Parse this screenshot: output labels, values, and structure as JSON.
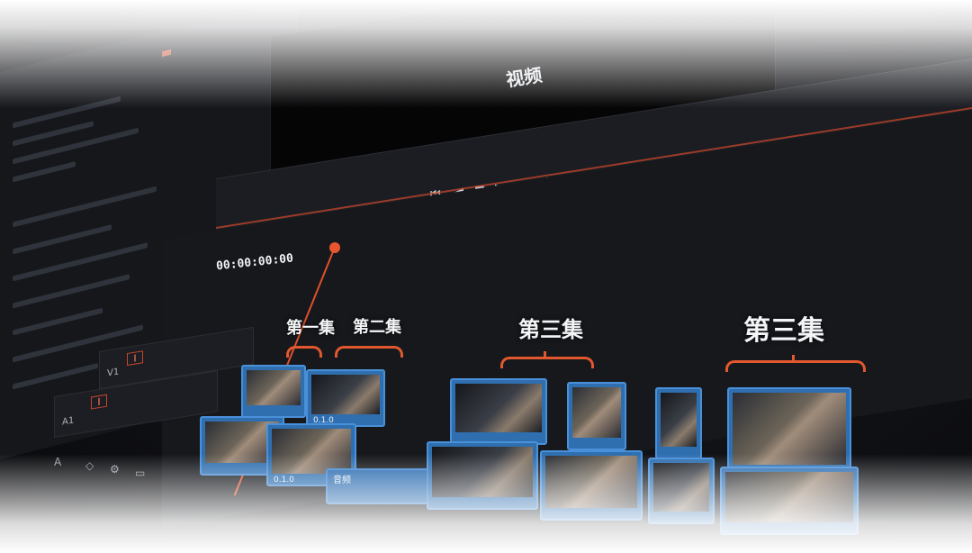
{
  "viewer": {
    "label": "视频"
  },
  "timeline": {
    "timecode": "00:00:00:00"
  },
  "episodes": [
    {
      "label": "第一集"
    },
    {
      "label": "第二集"
    },
    {
      "label": "第三集"
    },
    {
      "label": "第三集"
    }
  ],
  "toolbar": {
    "transport": [
      "⏮",
      "◀",
      "■",
      "▶",
      "⏭",
      "↻"
    ],
    "tools": [
      "✂",
      "🔗",
      "🔒"
    ],
    "flag_color": "#3b82f6",
    "marker_color": "#2f7fe0"
  },
  "tracks": {
    "video_header": {
      "name": "V1"
    },
    "audio_header": {
      "name": "A1"
    }
  },
  "clips": {
    "caption_1": "0.1.0",
    "caption_2": "0.1.0",
    "audio_label": "音频"
  },
  "colors": {
    "accent": "#e2582e",
    "clip_blue": "#2f6fb0",
    "background": "#101115"
  },
  "icons": [
    "play-icon",
    "stop-icon",
    "next-icon",
    "prev-icon",
    "loop-icon",
    "razor-icon",
    "link-icon",
    "lock-icon",
    "flag-icon",
    "zoom-icon",
    "volume-icon",
    "fullscreen-icon"
  ]
}
